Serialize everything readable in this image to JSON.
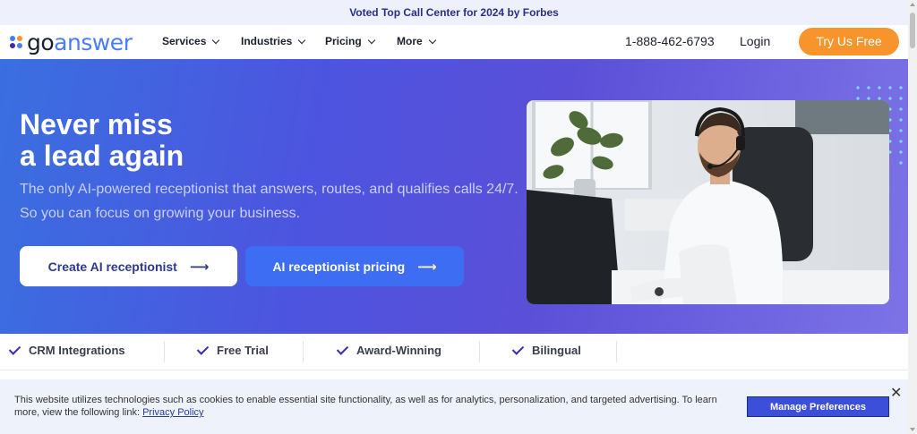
{
  "announcement": "Voted Top Call Center for 2024 by Forbes",
  "logo": {
    "part1": "go",
    "part2": "answer",
    "icon": "logo-dots-icon"
  },
  "nav": {
    "items": [
      {
        "label": "Services"
      },
      {
        "label": "Industries"
      },
      {
        "label": "Pricing"
      },
      {
        "label": "More"
      }
    ],
    "phone": "1-888-462-6793",
    "login": "Login",
    "cta": "Try Us Free"
  },
  "hero": {
    "title_line1": "Never miss",
    "title_line2": "a lead again",
    "subtitle": "The only AI-powered receptionist that answers, routes, and qualifies calls 24/7. So you can focus on growing your business.",
    "primary_btn": "Create AI receptionist",
    "secondary_btn": "AI receptionist pricing",
    "image": "man-with-headset-at-desk"
  },
  "features": [
    {
      "label": "CRM Integrations"
    },
    {
      "label": "Free Trial"
    },
    {
      "label": "Award-Winning"
    },
    {
      "label": "Bilingual"
    }
  ],
  "cookie": {
    "text": "This website utilizes technologies such as cookies to enable essential site functionality, as well as for analytics, personalization, and targeted advertising. To learn more, view the following link:",
    "link": "Privacy Policy",
    "button": "Manage Preferences",
    "close": "✕"
  },
  "colors": {
    "brand_orange": "#f7942b",
    "brand_blue": "#3d6df2",
    "brand_purple": "#5b4fd8",
    "check": "#3b2bb0"
  }
}
